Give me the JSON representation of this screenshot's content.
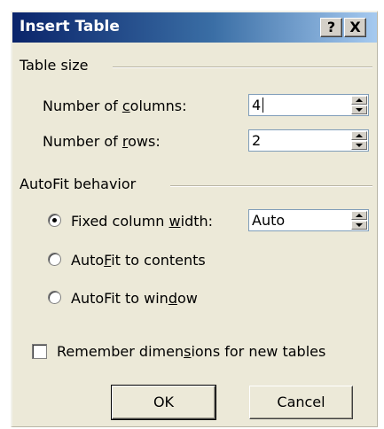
{
  "title": "Insert Table",
  "titlebar": {
    "help": "?",
    "close": "X"
  },
  "table_size": {
    "label": "Table size",
    "columns": {
      "label_pre": "Number of ",
      "label_ul": "c",
      "label_post": "olumns:",
      "value": "4"
    },
    "rows": {
      "label_pre": "Number of ",
      "label_ul": "r",
      "label_post": "ows:",
      "value": "2"
    }
  },
  "autofit": {
    "label": "AutoFit behavior",
    "fixed": {
      "label_pre": "Fixed column ",
      "label_ul": "w",
      "label_post": "idth:",
      "value": "Auto",
      "selected": true
    },
    "contents": {
      "label_pre": "Auto",
      "label_ul": "F",
      "label_post": "it to contents",
      "selected": false
    },
    "window": {
      "label_pre": "AutoFit to win",
      "label_ul": "d",
      "label_post": "ow",
      "selected": false
    }
  },
  "remember": {
    "label_pre": "Remember dimen",
    "label_ul": "s",
    "label_post": "ions for new tables",
    "checked": false
  },
  "buttons": {
    "ok": "OK",
    "cancel": "Cancel"
  }
}
